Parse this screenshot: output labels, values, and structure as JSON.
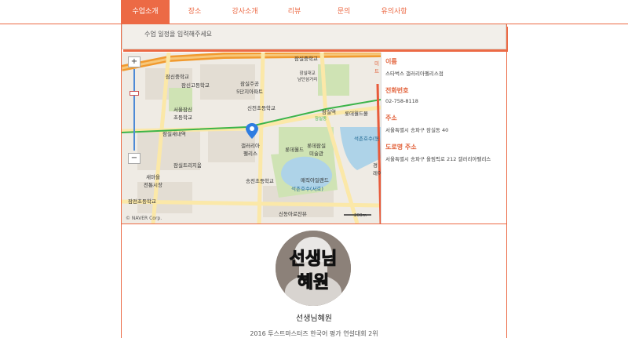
{
  "nav": {
    "tabs": [
      {
        "label": "수업소개",
        "active": true
      },
      {
        "label": "장소",
        "active": false
      },
      {
        "label": "강사소개",
        "active": false
      },
      {
        "label": "리뷰",
        "active": false
      },
      {
        "label": "문의",
        "active": false
      },
      {
        "label": "유의사항",
        "active": false
      }
    ]
  },
  "schedule": {
    "text": "수업 일정을 입력해주세요"
  },
  "map": {
    "copyright": "© NAVER Corp.",
    "scale": "200m",
    "zoom_in": "+",
    "zoom_out": "−",
    "labels": {
      "l1": "잠실중학교",
      "l2": "잠신중학교",
      "l3": "잠신고등학교",
      "l4": "잠실주공\n5단지아파트",
      "l5": "서울잠신\n초등학교",
      "l6": "신천초등학교",
      "l7": "잠실새내역",
      "l8": "잠실역",
      "l9": "롯데월드몰",
      "l10": "갤러리아\n펠리스",
      "l11": "롯데월드",
      "l12": "롯데잠실\n미술관",
      "l13": "석촌호수(동",
      "l14": "잠실트리지움",
      "l15": "새마을\n전통시장",
      "l16": "송전초등학교",
      "l17": "매직아일랜드",
      "l18": "석촌호수(서호)",
      "l19": "잠전초등학교",
      "l20": "신동아로잔뷰",
      "l21": "경\n레이크",
      "l22": "잠실대교\n남단삼거리",
      "l23": "잠실동",
      "l24": "미\n트"
    }
  },
  "info": {
    "name_label": "이름",
    "name_value": "스타벅스 갤러리아펠리스점",
    "phone_label": "전화번호",
    "phone_value": "02-758-8118",
    "address_label": "주소",
    "address_value": "서울특별시 송파구 잠실동 40",
    "road_label": "도로명 주소",
    "road_value": "서울특별시 송파구 올림픽로 212 갤러리아펠리스"
  },
  "profile": {
    "image_text_top": "선생님",
    "image_text_bottom": "혜원",
    "name": "선생님혜원",
    "career": "2016 투스트마스터즈 한국어 평가 연설대회 2위"
  },
  "colors": {
    "accent": "#ec6a45",
    "highway": "#f19a2f",
    "park": "#cfe3b4",
    "water": "#aed3e8"
  }
}
